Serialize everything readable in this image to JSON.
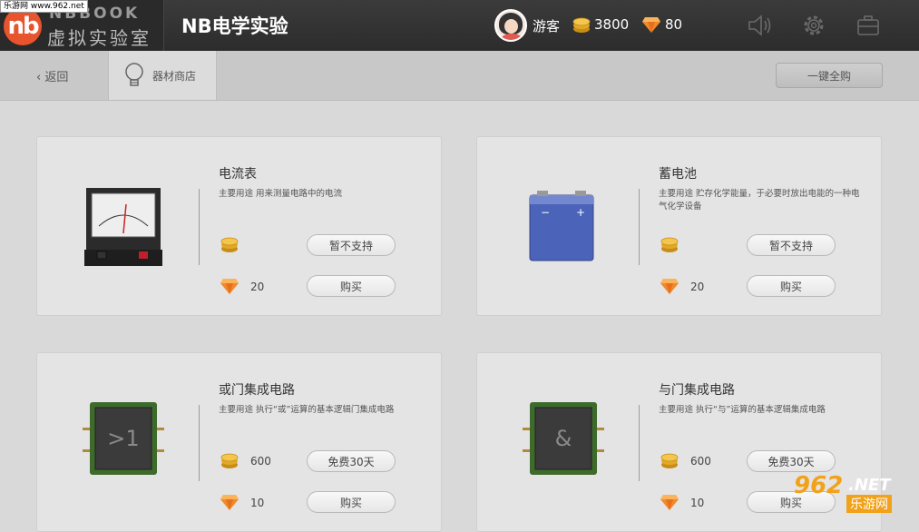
{
  "site_tag": "乐游网 www.962.net",
  "brand": {
    "logo_letters": "nb",
    "top_text": "NBBOOK",
    "sub_text": "虚拟实验室"
  },
  "app_title": "NB电学实验",
  "user": {
    "name": "游客",
    "coins": "3800",
    "gems": "80"
  },
  "subbar": {
    "back_label": "返回",
    "tab_label": "器材商店",
    "buy_all_label": "一键全购"
  },
  "items": [
    {
      "title": "电流表",
      "desc": "主要用途 用来测量电路中的电流",
      "coin_price": "",
      "gem_price": "20",
      "btn1": "暂不支持",
      "btn2": "购买"
    },
    {
      "title": "蓄电池",
      "desc": "主要用途 贮存化学能量，于必要时放出电能的一种电气化学设备",
      "coin_price": "",
      "gem_price": "20",
      "btn1": "暂不支持",
      "btn2": "购买"
    },
    {
      "title": "或门集成电路",
      "desc": "主要用途 执行“或”运算的基本逻辑门集成电路",
      "coin_price": "600",
      "gem_price": "10",
      "btn1": "免费30天",
      "btn2": "购买",
      "chip_symbol": ">1"
    },
    {
      "title": "与门集成电路",
      "desc": "主要用途 执行“与”运算的基本逻辑集成电路",
      "coin_price": "600",
      "gem_price": "10",
      "btn1": "免费30天",
      "btn2": "购买",
      "chip_symbol": "&"
    }
  ],
  "battery_signs": {
    "minus": "−",
    "plus": "+"
  },
  "watermark": {
    "number": "962",
    "net": ".NET",
    "name": "乐游网"
  },
  "colors": {
    "topbar": "#2c2c2c",
    "logo": "#e8542d",
    "coin": "#e0a92a",
    "gem": "#f08a2c",
    "chip": "#3e6b2c"
  }
}
